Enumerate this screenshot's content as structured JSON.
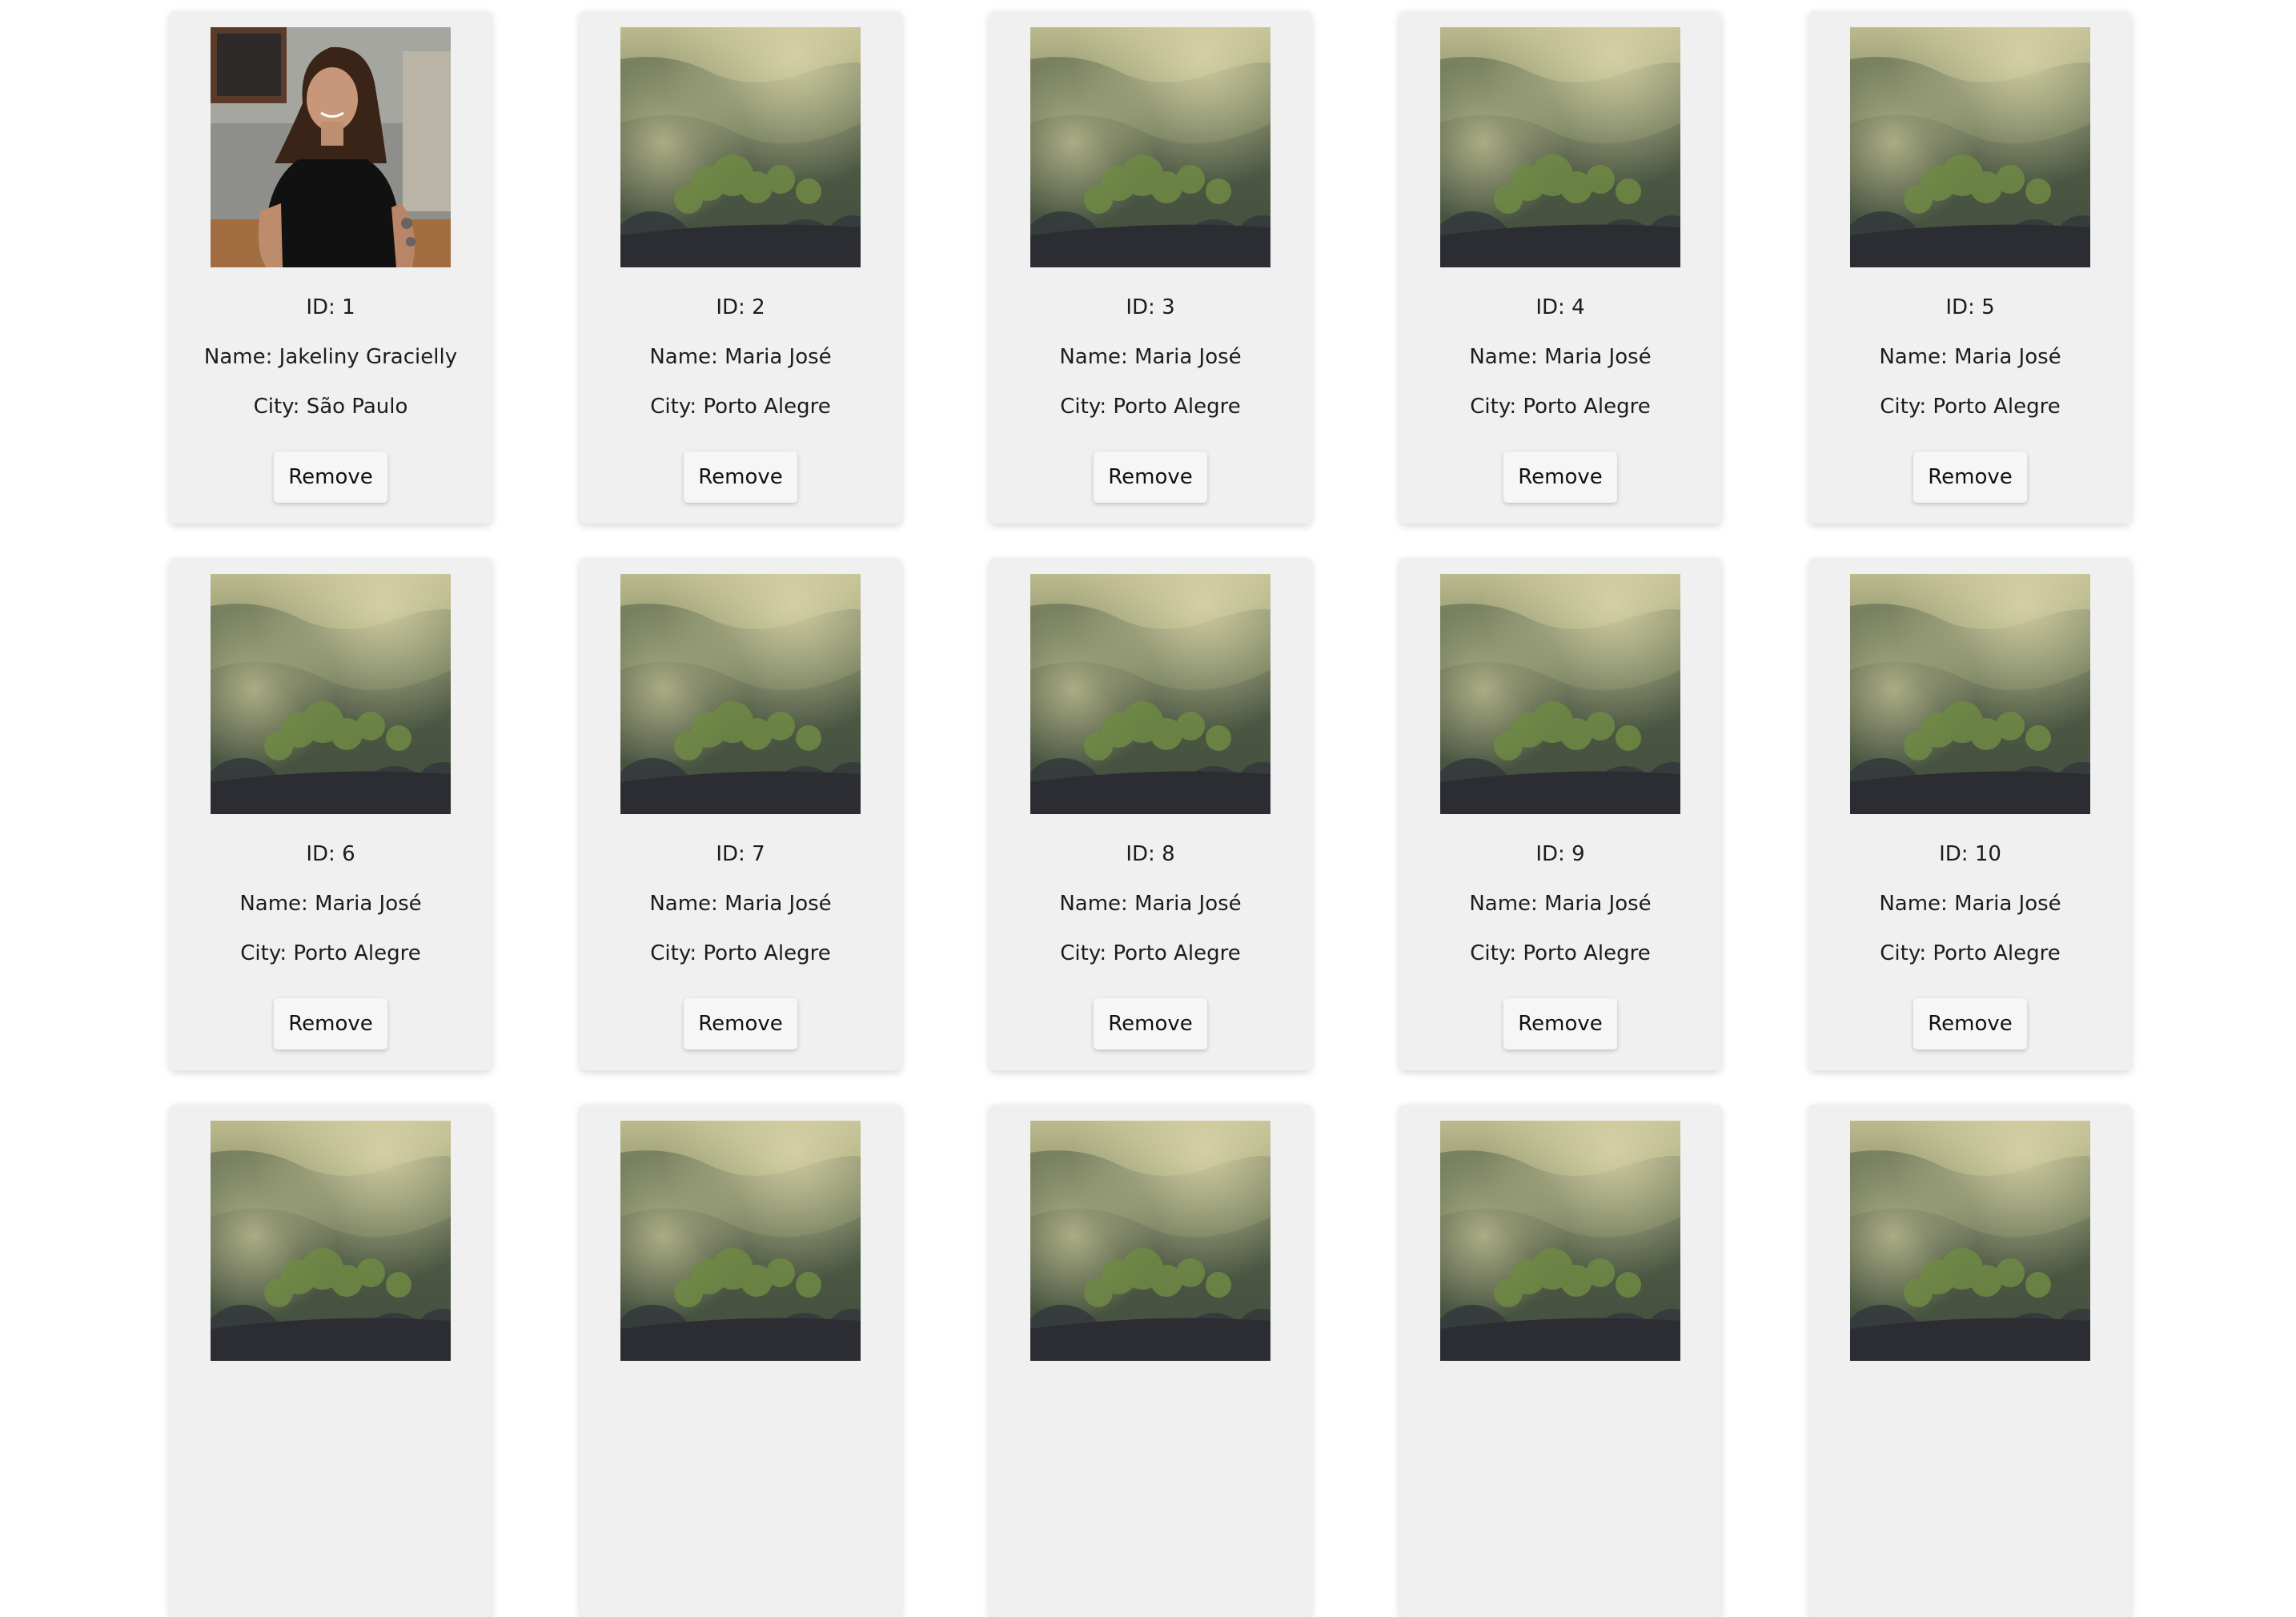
{
  "labels": {
    "id": "ID: ",
    "name": "Name: ",
    "city": "City: "
  },
  "remove_label": "Remove",
  "colors": {
    "card_background": "#f0f0f0",
    "page_background": "#ffffff",
    "forest_light": "#c7c49a",
    "forest_dark": "#2f3438",
    "forest_green": "#5f7347"
  },
  "users": [
    {
      "id": "1",
      "name": "Jakeliny Gracielly",
      "city": "São Paulo",
      "photo": "portrait-photo"
    },
    {
      "id": "2",
      "name": "Maria José",
      "city": "Porto Alegre",
      "photo": "forest-photo"
    },
    {
      "id": "3",
      "name": "Maria José",
      "city": "Porto Alegre",
      "photo": "forest-photo"
    },
    {
      "id": "4",
      "name": "Maria José",
      "city": "Porto Alegre",
      "photo": "forest-photo"
    },
    {
      "id": "5",
      "name": "Maria José",
      "city": "Porto Alegre",
      "photo": "forest-photo"
    },
    {
      "id": "6",
      "name": "Maria José",
      "city": "Porto Alegre",
      "photo": "forest-photo"
    },
    {
      "id": "7",
      "name": "Maria José",
      "city": "Porto Alegre",
      "photo": "forest-photo"
    },
    {
      "id": "8",
      "name": "Maria José",
      "city": "Porto Alegre",
      "photo": "forest-photo"
    },
    {
      "id": "9",
      "name": "Maria José",
      "city": "Porto Alegre",
      "photo": "forest-photo"
    },
    {
      "id": "10",
      "name": "Maria José",
      "city": "Porto Alegre",
      "photo": "forest-photo"
    },
    {
      "photo": "forest-photo"
    },
    {
      "photo": "forest-photo"
    },
    {
      "photo": "forest-photo"
    },
    {
      "photo": "forest-photo"
    },
    {
      "photo": "forest-photo"
    }
  ]
}
